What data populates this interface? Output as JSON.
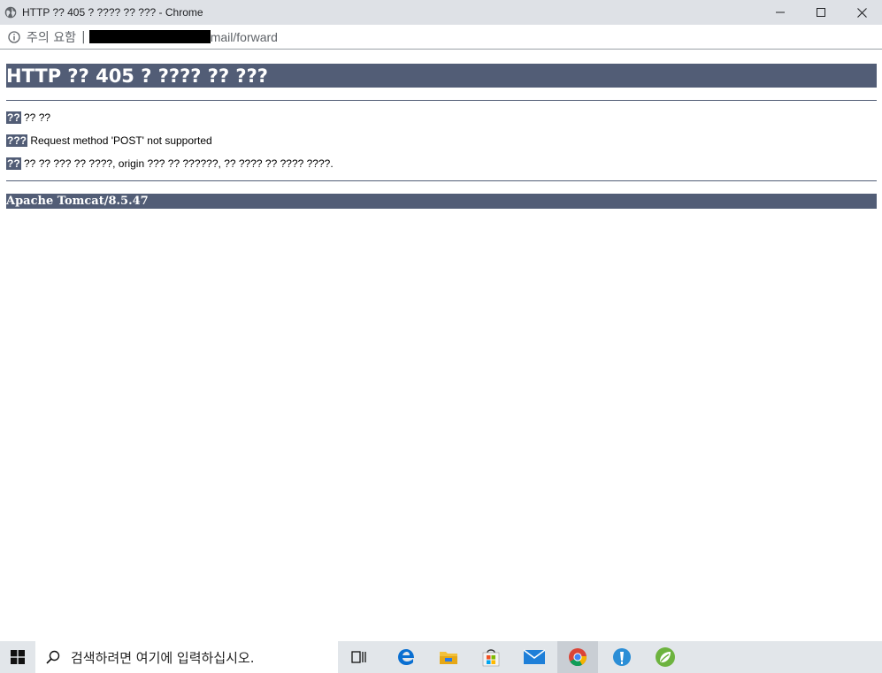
{
  "window": {
    "title": "HTTP ?? 405 ? ???? ?? ??? - Chrome"
  },
  "address_bar": {
    "security_label": "주의 요함",
    "separator": "|",
    "url_visible": "mail/forward"
  },
  "page": {
    "heading": "HTTP ?? 405 ? ???? ?? ???",
    "lines": [
      {
        "label": "??",
        "text": " ?? ??"
      },
      {
        "label": "???",
        "text": " Request method 'POST' not supported"
      },
      {
        "label": "??",
        "text": " ?? ?? ??? ?? ????, origin ??? ?? ??????, ?? ???? ?? ???? ????."
      }
    ],
    "footer": "Apache Tomcat/8.5.47"
  },
  "taskbar": {
    "search_placeholder": "검색하려면 여기에 입력하십시오.",
    "apps": [
      "task-view",
      "edge",
      "file-explorer",
      "store",
      "mail",
      "chrome",
      "app-blue",
      "app-green"
    ]
  },
  "colors": {
    "tomcat_bar": "#525d76",
    "titlebar": "#dee1e6",
    "taskbar": "#e2e6ea"
  }
}
